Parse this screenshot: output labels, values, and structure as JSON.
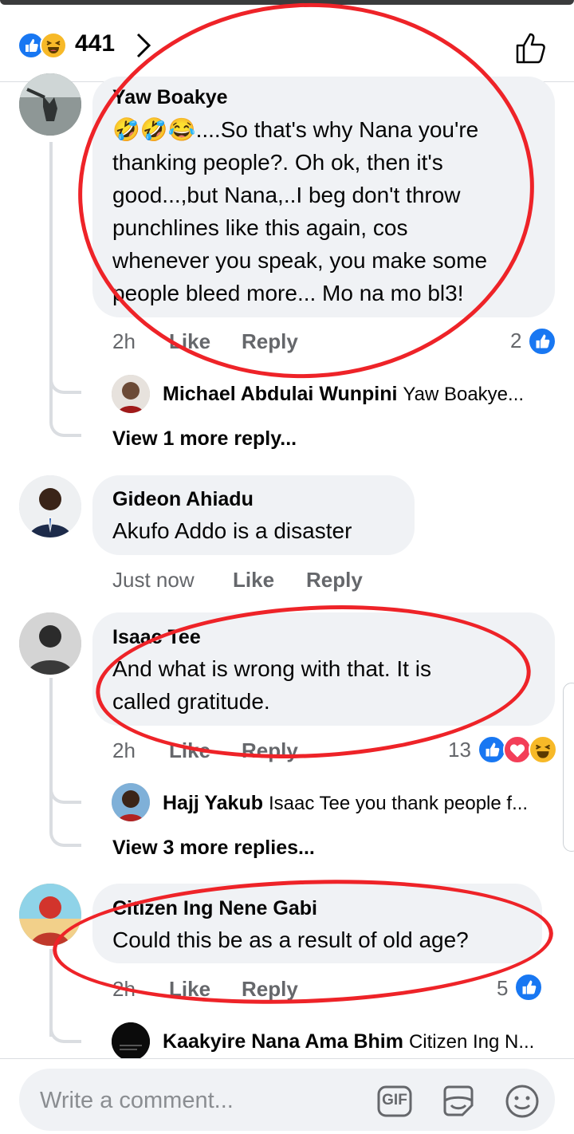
{
  "header": {
    "reaction_count": "441",
    "reactions": [
      "like-icon",
      "haha-icon"
    ]
  },
  "comments": [
    {
      "author": "Yaw Boakye",
      "text_lines": [
        "🤣🤣😂....So that's why Nana you're",
        "thanking people?. Oh ok, then it's",
        "good...,but  Nana,..I beg don't throw",
        "punchlines like this again, cos",
        "whenever you speak, you make some",
        "people bleed more... Mo na mo bl3!"
      ],
      "time": "2h",
      "like_label": "Like",
      "reply_label": "Reply",
      "reaction_count": "2",
      "reply_preview": {
        "author": "Michael Abdulai Wunpini",
        "text": "Yaw Boakye..."
      },
      "view_more": "View 1 more reply..."
    },
    {
      "author": "Gideon Ahiadu",
      "text_lines": [
        "Akufo Addo is a disaster"
      ],
      "time": "Just now",
      "like_label": "Like",
      "reply_label": "Reply"
    },
    {
      "author": "Isaac Tee",
      "text_lines": [
        "And what is wrong with that. It is",
        "called gratitude."
      ],
      "time": "2h",
      "like_label": "Like",
      "reply_label": "Reply",
      "reaction_count": "13",
      "reply_preview": {
        "author": "Hajj Yakub",
        "text": "Isaac Tee you thank people f..."
      },
      "view_more": "View 3 more replies..."
    },
    {
      "author": "Citizen Ing Nene Gabi",
      "text_lines": [
        "Could this be as a result of old age?"
      ],
      "time": "2h",
      "like_label": "Like",
      "reply_label": "Reply",
      "reaction_count": "5",
      "reply_preview": {
        "author": "Kaakyire Nana Ama Bhim",
        "text": "Citizen Ing N..."
      }
    }
  ],
  "composer": {
    "placeholder": "Write a comment...",
    "gif_label": "GIF"
  },
  "colors": {
    "like_blue": "#1877f2",
    "annotation_red": "#ee2328",
    "bubble_gray": "#f0f2f5",
    "meta_gray": "#65676b"
  }
}
